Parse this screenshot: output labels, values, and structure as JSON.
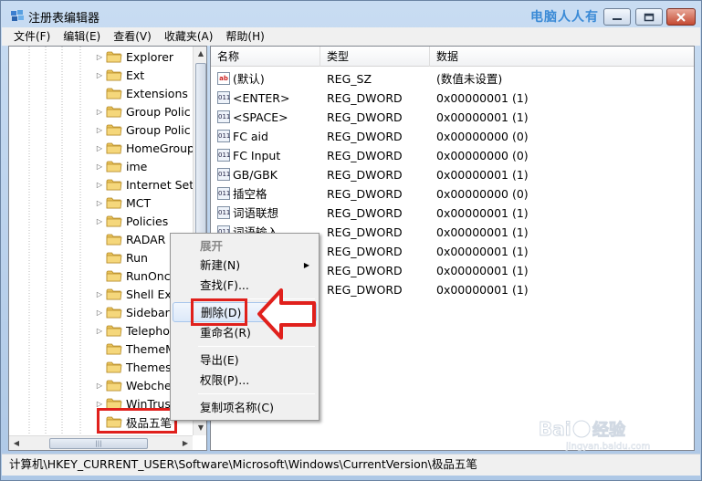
{
  "window": {
    "title": "注册表编辑器",
    "watermark": "电脑人人有"
  },
  "menubar": [
    "文件(F)",
    "编辑(E)",
    "查看(V)",
    "收藏夹(A)",
    "帮助(H)"
  ],
  "tree": {
    "items": [
      {
        "label": "Explorer",
        "expander": "▷"
      },
      {
        "label": "Ext",
        "expander": "▷"
      },
      {
        "label": "Extensions",
        "expander": ""
      },
      {
        "label": "Group Polic",
        "expander": "▷"
      },
      {
        "label": "Group Polic",
        "expander": "▷"
      },
      {
        "label": "HomeGroup",
        "expander": "▷"
      },
      {
        "label": "ime",
        "expander": "▷"
      },
      {
        "label": "Internet Sett",
        "expander": "▷"
      },
      {
        "label": "MCT",
        "expander": "▷"
      },
      {
        "label": "Policies",
        "expander": "▷"
      },
      {
        "label": "RADAR",
        "expander": ""
      },
      {
        "label": "Run",
        "expander": ""
      },
      {
        "label": "RunOnce",
        "expander": ""
      },
      {
        "label": "Shell Ext",
        "expander": "▷"
      },
      {
        "label": "Sidebar",
        "expander": "▷"
      },
      {
        "label": "Telepho",
        "expander": "▷"
      },
      {
        "label": "ThemeM",
        "expander": ""
      },
      {
        "label": "Themes",
        "expander": ""
      },
      {
        "label": "Webche",
        "expander": "▷"
      },
      {
        "label": "WinTrus",
        "expander": "▷"
      },
      {
        "label": "极品五笔",
        "expander": ""
      }
    ]
  },
  "list": {
    "columns": [
      "名称",
      "类型",
      "数据"
    ],
    "rows": [
      {
        "name": "(默认)",
        "type": "REG_SZ",
        "data": "(数值未设置)",
        "icon": "ab"
      },
      {
        "name": "<ENTER>",
        "type": "REG_DWORD",
        "data": "0x00000001 (1)",
        "icon": "011"
      },
      {
        "name": "<SPACE>",
        "type": "REG_DWORD",
        "data": "0x00000001 (1)",
        "icon": "011"
      },
      {
        "name": "FC aid",
        "type": "REG_DWORD",
        "data": "0x00000000 (0)",
        "icon": "011"
      },
      {
        "name": "FC Input",
        "type": "REG_DWORD",
        "data": "0x00000000 (0)",
        "icon": "011"
      },
      {
        "name": "GB/GBK",
        "type": "REG_DWORD",
        "data": "0x00000001 (1)",
        "icon": "011"
      },
      {
        "name": "插空格",
        "type": "REG_DWORD",
        "data": "0x00000000 (0)",
        "icon": "011"
      },
      {
        "name": "词语联想",
        "type": "REG_DWORD",
        "data": "0x00000001 (1)",
        "icon": "011"
      },
      {
        "name": "词语输入",
        "type": "REG_DWORD",
        "data": "0x00000001 (1)",
        "icon": "011"
      },
      {
        "name": "",
        "type": "REG_DWORD",
        "data": "0x00000001 (1)",
        "icon": ""
      },
      {
        "name": "",
        "type": "REG_DWORD",
        "data": "0x00000001 (1)",
        "icon": ""
      },
      {
        "name": "",
        "type": "REG_DWORD",
        "data": "0x00000001 (1)",
        "icon": ""
      }
    ]
  },
  "context_menu": {
    "expand": "展开",
    "new": "新建(N)",
    "find": "查找(F)...",
    "delete": "删除(D)",
    "rename": "重命名(R)",
    "export": "导出(E)",
    "permissions": "权限(P)...",
    "copy_key_name": "复制项名称(C)"
  },
  "statusbar": {
    "path": "计算机\\HKEY_CURRENT_USER\\Software\\Microsoft\\Windows\\CurrentVersion\\极品五笔"
  },
  "icons": {
    "app": "regedit-icon",
    "folder": "folder-icon",
    "string_value": "string-value-icon",
    "dword_value": "dword-value-icon",
    "annotation_arrow": "red-arrow-icon",
    "logo": "baidu-logo-icon"
  },
  "colors": {
    "annotation_red": "#e0201c",
    "watermark_blue": "#3a8ad6"
  },
  "logo_text": "Bai 经验 jingyan.baidu.com"
}
